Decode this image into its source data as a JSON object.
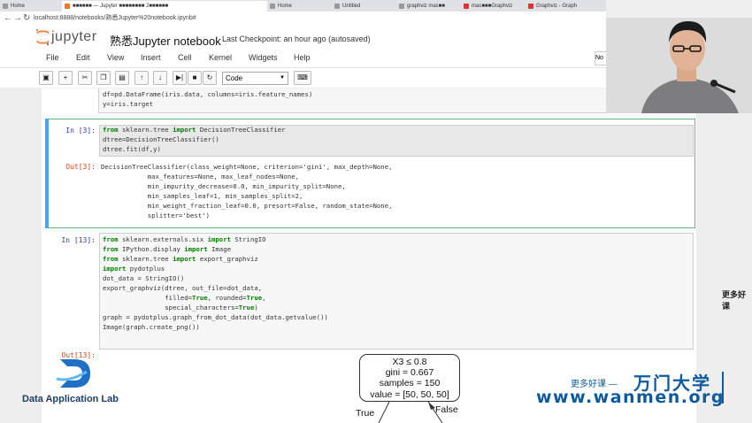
{
  "browser": {
    "tabs": [
      "Home",
      "■■■■■■ — Jupyter ■■■■■■■■ 2■■■■■■",
      "Home",
      "Untitled",
      "graphviz mac■■",
      "mac■■■Graphviz",
      "Graphviz - Graph"
    ],
    "url": "localhost:8888/notebooks/熟悉Jupyter%20notebook.ipynb#"
  },
  "jupyter": {
    "logo": "jupyter",
    "title": "熟悉Jupyter notebook",
    "checkpoint": "Last Checkpoint: an hour ago (autosaved)",
    "kernel_indicator": "No",
    "menu": [
      "File",
      "Edit",
      "View",
      "Insert",
      "Cell",
      "Kernel",
      "Widgets",
      "Help"
    ],
    "toolbar_icons": [
      "save-icon",
      "plus-icon",
      "cut-icon",
      "copy-icon",
      "paste-icon",
      "arrow-up-icon",
      "arrow-down-icon",
      "skip-forward-icon",
      "stop-icon",
      "restart-icon",
      "keyboard-icon"
    ],
    "cell_type": "Code"
  },
  "cells": {
    "prev_lines": [
      "df=pd.DataFrame(iris.data, columns=iris.feature_names)",
      "y=iris.target"
    ],
    "cell3": {
      "in_prompt": "In  [3]:",
      "lines": [
        {
          "kw": "from",
          "a": " sklearn.tree ",
          "kw2": "import",
          "b": " DecisionTreeClassifier"
        },
        {
          "text": "dtree=DecisionTreeClassifier()"
        },
        {
          "text": "dtree.fit(df,y)"
        }
      ],
      "out_prompt": "Out[3]:",
      "output": [
        "DecisionTreeClassifier(class_weight=None, criterion='gini', max_depth=None,",
        "            max_features=None, max_leaf_nodes=None,",
        "            min_impurity_decrease=0.0, min_impurity_split=None,",
        "            min_samples_leaf=1, min_samples_split=2,",
        "            min_weight_fraction_leaf=0.0, presort=False, random_state=None,",
        "            splitter='best')"
      ]
    },
    "cell13": {
      "in_prompt": "In  [13]:",
      "line1": {
        "kw": "from",
        "a": " sklearn.externals.six ",
        "kw2": "import",
        "b": " StringIO"
      },
      "line2": {
        "kw": "from",
        "a": " IPython.display ",
        "kw2": "import",
        "b": " Image"
      },
      "line3": {
        "kw": "from",
        "a": " sklearn.tree ",
        "kw2": "import",
        "b": " export_graphviz"
      },
      "line4": {
        "kw": "import",
        "b": " pydotplus"
      },
      "line5": "dot_data = StringIO()",
      "line6": "export_graphviz(dtree, out_file=dot_data,",
      "line7": {
        "a": "                filled=",
        "kw": "True",
        "b": ", rounded=",
        "kw2": "True",
        "c": ","
      },
      "line8": {
        "a": "                special_characters=",
        "kw": "True",
        "b": ")"
      },
      "line9": "graph = pydotplus.graph_from_dot_data(dot_data.getvalue())",
      "line10": "Image(graph.create_png())",
      "out_prompt": "Out[13]:"
    }
  },
  "tree": {
    "root_lines": [
      "X3 ≤ 0.8",
      "gini = 0.667",
      "samples = 150",
      "value = [50, 50, 50]"
    ],
    "true_label": "True",
    "false_label": "False"
  },
  "watermarks": {
    "lab": "Data Application Lab",
    "right_edge_text": "更多好课",
    "more_courses": "更多好课 —",
    "brand": "万门大学",
    "url": "www.wanmen.org"
  },
  "colors": {
    "keyword": "#008000",
    "in_prompt": "#303f9f",
    "out_prompt": "#d84315",
    "brand_blue": "#0d5a9e",
    "jupyter_orange": "#f37626"
  }
}
